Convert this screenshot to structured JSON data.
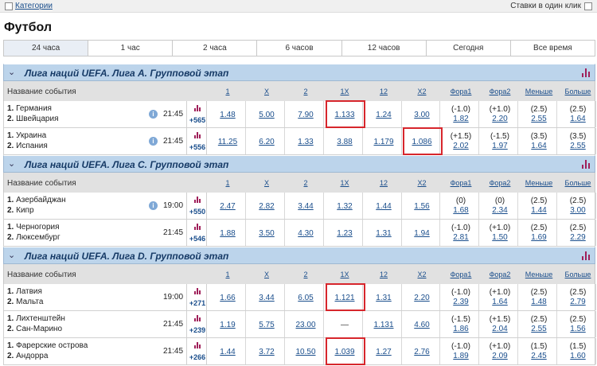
{
  "topbar": {
    "categories_label": "Категории",
    "one_click_label": "Ставки в один клик"
  },
  "page_title": "Футбол",
  "tabs": [
    {
      "label": "24 часа",
      "active": true
    },
    {
      "label": "1 час"
    },
    {
      "label": "2 часа"
    },
    {
      "label": "6 часов"
    },
    {
      "label": "12 часов"
    },
    {
      "label": "Сегодня"
    },
    {
      "label": "Все время"
    }
  ],
  "columns": {
    "event": "Название события",
    "c1": "1",
    "cx": "X",
    "c2": "2",
    "c1x": "1X",
    "c12": "12",
    "cx2": "X2",
    "f1": "Фора1",
    "f2": "Фора2",
    "under": "Меньше",
    "over": "Больше"
  },
  "leagues": [
    {
      "title": "Лига наций UEFA. Лига А. Групповой этап",
      "matches": [
        {
          "team1": "Германия",
          "team2": "Швейцария",
          "info": true,
          "time": "21:45",
          "markets": "+565",
          "odds": [
            "1.48",
            "5.00",
            "7.90",
            "1.133",
            "1.24",
            "3.00"
          ],
          "f1": [
            "(-1.0)",
            "1.82"
          ],
          "f2": [
            "(+1.0)",
            "2.20"
          ],
          "under": [
            "(2.5)",
            "2.55"
          ],
          "over": [
            "(2.5)",
            "1.64"
          ]
        },
        {
          "team1": "Украина",
          "team2": "Испания",
          "info": true,
          "time": "21:45",
          "markets": "+556",
          "odds": [
            "11.25",
            "6.20",
            "1.33",
            "3.88",
            "1.179",
            "1.086"
          ],
          "f1": [
            "(+1.5)",
            "2.02"
          ],
          "f2": [
            "(-1.5)",
            "1.97"
          ],
          "under": [
            "(3.5)",
            "1.64"
          ],
          "over": [
            "(3.5)",
            "2.55"
          ]
        }
      ]
    },
    {
      "title": "Лига наций UEFA. Лига С. Групповой этап",
      "matches": [
        {
          "team1": "Азербайджан",
          "team2": "Кипр",
          "info": true,
          "time": "19:00",
          "markets": "+550",
          "odds": [
            "2.47",
            "2.82",
            "3.44",
            "1.32",
            "1.44",
            "1.56"
          ],
          "f1": [
            "(0)",
            "1.68"
          ],
          "f2": [
            "(0)",
            "2.34"
          ],
          "under": [
            "(2.5)",
            "1.44"
          ],
          "over": [
            "(2.5)",
            "3.00"
          ]
        },
        {
          "team1": "Черногория",
          "team2": "Люксембург",
          "info": false,
          "time": "21:45",
          "markets": "+546",
          "odds": [
            "1.88",
            "3.50",
            "4.30",
            "1.23",
            "1.31",
            "1.94"
          ],
          "f1": [
            "(-1.0)",
            "2.81"
          ],
          "f2": [
            "(+1.0)",
            "1.50"
          ],
          "under": [
            "(2.5)",
            "1.69"
          ],
          "over": [
            "(2.5)",
            "2.29"
          ]
        }
      ]
    },
    {
      "title": "Лига наций UEFA. Лига D. Групповой этап",
      "matches": [
        {
          "team1": "Латвия",
          "team2": "Мальта",
          "info": false,
          "time": "19:00",
          "markets": "+271",
          "odds": [
            "1.66",
            "3.44",
            "6.05",
            "1.121",
            "1.31",
            "2.20"
          ],
          "f1": [
            "(-1.0)",
            "2.39"
          ],
          "f2": [
            "(+1.0)",
            "1.64"
          ],
          "under": [
            "(2.5)",
            "1.48"
          ],
          "over": [
            "(2.5)",
            "2.79"
          ]
        },
        {
          "team1": "Лихтенштейн",
          "team2": "Сан-Марино",
          "info": false,
          "time": "21:45",
          "markets": "+239",
          "odds": [
            "1.19",
            "5.75",
            "23.00",
            "—",
            "1.131",
            "4.60"
          ],
          "f1": [
            "(-1.5)",
            "1.86"
          ],
          "f2": [
            "(+1.5)",
            "2.04"
          ],
          "under": [
            "(2.5)",
            "2.55"
          ],
          "over": [
            "(2.5)",
            "1.56"
          ]
        },
        {
          "team1": "Фарерские острова",
          "team2": "Андорра",
          "info": false,
          "time": "21:45",
          "markets": "+266",
          "odds": [
            "1.44",
            "3.72",
            "10.50",
            "1.039",
            "1.27",
            "2.76"
          ],
          "f1": [
            "(-1.0)",
            "1.89"
          ],
          "f2": [
            "(+1.0)",
            "2.09"
          ],
          "under": [
            "(1.5)",
            "2.45"
          ],
          "over": [
            "(1.5)",
            "1.60"
          ]
        }
      ]
    }
  ]
}
